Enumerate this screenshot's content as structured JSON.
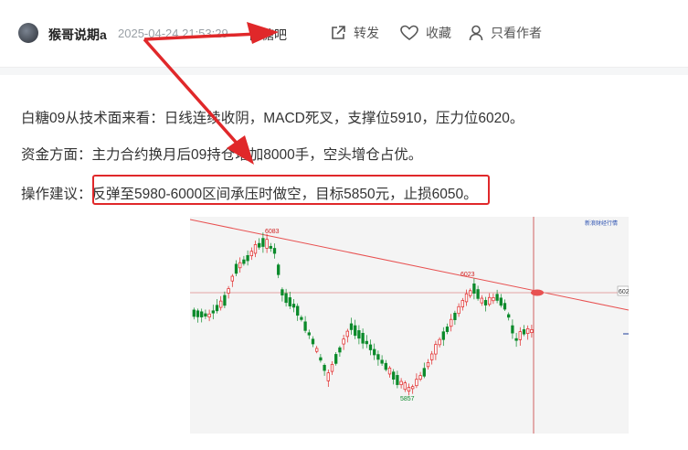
{
  "header": {
    "author": "猴哥说期a",
    "timestamp": "2025-04-24 21:53:29",
    "forum": "白糖吧",
    "share_label": "转发",
    "favorite_label": "收藏",
    "only_author_label": "只看作者"
  },
  "post": {
    "paragraph1": "白糖09从技术面来看：日线连续收阴，MACD死叉，支撑位5910，压力位6020。",
    "paragraph2": "资金方面：主力合约换月后09持仓增加8000手，空头增仓占优。",
    "paragraph3_prefix": "操作建议：",
    "paragraph3_highlight": "反弹至5980-6000区间承压时做空，目标5850元，止损6050。"
  },
  "chart": {
    "high_label": "6083",
    "mid_label": "6023",
    "low_label": "5857",
    "right_label": "602",
    "corner_text": "新浪财经行情",
    "colors": {
      "up": "#e02020",
      "down": "#0a8a2a",
      "trend": "#e85050",
      "crosshair": "#c83a3a",
      "annotation": "#e0282a"
    }
  },
  "chart_data": {
    "type": "candlestick",
    "annotations": [
      "6083",
      "6023",
      "5857"
    ]
  }
}
